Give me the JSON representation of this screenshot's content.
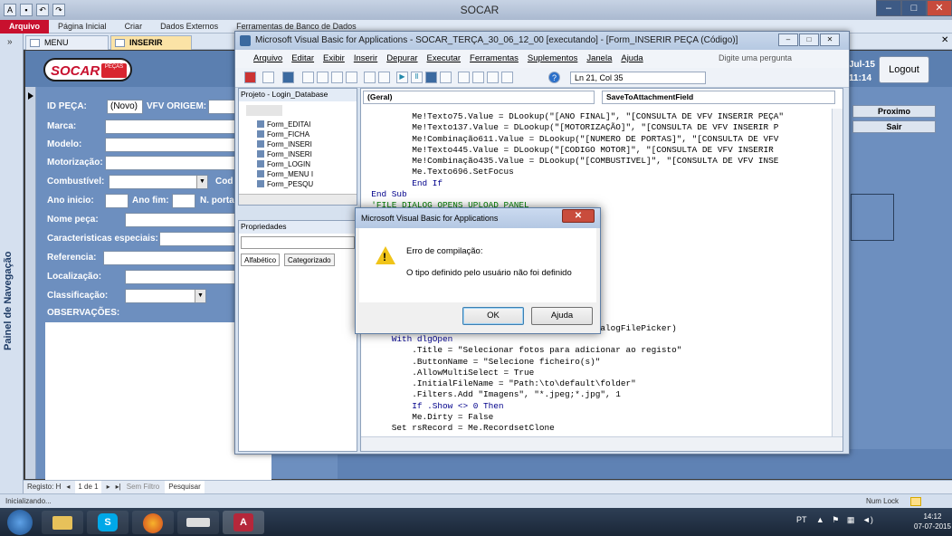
{
  "access": {
    "title": "SOCAR",
    "ribbon_tabs": [
      "Arquivo",
      "Página Inicial",
      "Criar",
      "Dados Externos",
      "Ferramentas de Banco de Dados"
    ],
    "nav_pane_label": "Painel de Navegação",
    "doc_tabs": [
      "MENU PRINCIPAL",
      "INSERIR PEÇA"
    ]
  },
  "form": {
    "logo_text": "SOCAR",
    "logo_sub": "PEÇAS",
    "id_label": "ID PEÇA:",
    "id_value": "(Novo)",
    "vfv_label": "VFV ORIGEM:",
    "labels": {
      "marca": "Marca:",
      "modelo": "Modelo:",
      "motorizacao": "Motorização:",
      "combustivel": "Combustível:",
      "cod": "Cod",
      "ano_inicio": "Ano inicio:",
      "ano_fim": "Ano fim:",
      "n_portas": "N. porta",
      "nome_peca": "Nome peça:",
      "caracteristicas": "Caracteristicas especiais:",
      "referencia": "Referencia:",
      "localizacao": "Localização:",
      "classificacao": "Classificação:",
      "observacoes": "OBSERVAÇÕES:"
    },
    "date_top": "Jul-15",
    "time_top": "11:14",
    "logout": "Logout",
    "proximo": "Proximo",
    "sair": "Sair"
  },
  "record_nav": {
    "registo": "Registo: H",
    "pos": "1 de 1",
    "filtro": "Sem Filtro",
    "pesquisar": "Pesquisar"
  },
  "status": {
    "left": "Inicializando...",
    "right": "Num Lock"
  },
  "vba": {
    "title": "Microsoft Visual Basic for Applications - SOCAR_TERÇA_30_06_12_00 [executando] - [Form_INSERIR PEÇA (Código)]",
    "menu": [
      "Arquivo",
      "Editar",
      "Exibir",
      "Inserir",
      "Depurar",
      "Executar",
      "Ferramentas",
      "Suplementos",
      "Janela",
      "Ajuda"
    ],
    "ask_placeholder": "Digite uma pergunta",
    "position": "Ln 21, Col 35",
    "project_header": "Projeto - Login_Database",
    "project_items": [
      "Form_EDITAI",
      "Form_FICHA",
      "Form_INSERI",
      "Form_INSERI",
      "Form_LOGIN",
      "Form_MENU I",
      "Form_PESQU"
    ],
    "props_header": "Propriedades",
    "props_tabs": [
      "Alfabético",
      "Categorizado"
    ],
    "object_dd": "(Geral)",
    "proc_dd": "SaveToAttachmentField",
    "code_lines": [
      {
        "indent": "        ",
        "text": "Me!Texto75.Value = DLookup(\"[ANO FINAL]\", \"[CONSULTA DE VFV INSERIR PEÇA\"",
        "cls": ""
      },
      {
        "indent": "        ",
        "text": "Me!Texto137.Value = DLookup(\"[MOTORIZAÇÃO]\", \"[CONSULTA DE VFV INSERIR P",
        "cls": ""
      },
      {
        "indent": "        ",
        "text": "Me!Combinação611.Value = DLookup(\"[NUMERO DE PORTAS]\", \"[CONSULTA DE VFV",
        "cls": ""
      },
      {
        "indent": "        ",
        "text": "Me!Texto445.Value = DLookup(\"[CODIGO MOTOR]\", \"[CONSULTA DE VFV INSERIR",
        "cls": ""
      },
      {
        "indent": "        ",
        "text": "Me!Combinação435.Value = DLookup(\"[COMBUSTIVEL]\", \"[CONSULTA DE VFV INSE",
        "cls": ""
      },
      {
        "indent": "        ",
        "text": "Me.Texto696.SetFocus",
        "cls": ""
      },
      {
        "indent": "        ",
        "text": "End If",
        "cls": "kw"
      },
      {
        "indent": "",
        "text": "End Sub",
        "cls": "kw"
      },
      {
        "indent": "",
        "text": "'FILE DIALOG OPENS UPLOAD PANEL",
        "cls": "cm"
      },
      {
        "indent": "",
        "text": "",
        "cls": ""
      },
      {
        "indent": "",
        "text": "",
        "cls": ""
      },
      {
        "indent": "",
        "text": "",
        "cls": ""
      },
      {
        "indent": "",
        "text": "",
        "cls": ""
      },
      {
        "indent": "",
        "text": "",
        "cls": ""
      },
      {
        "indent": "",
        "text": "",
        "cls": ""
      },
      {
        "indent": "",
        "text": "",
        "cls": ""
      },
      {
        "indent": "",
        "text": "",
        "cls": ""
      },
      {
        "indent": "",
        "text": "",
        "cls": ""
      },
      {
        "indent": "",
        "text": "",
        "cls": ""
      },
      {
        "indent": "                                  ",
        "text": "g(msoFileDialogFilePicker)",
        "cls": ""
      },
      {
        "indent": "    ",
        "text": "With dlgOpen",
        "cls": "kw"
      },
      {
        "indent": "        ",
        "text": ".Title = \"Selecionar fotos para adicionar ao registo\"",
        "cls": ""
      },
      {
        "indent": "        ",
        "text": ".ButtonName = \"Selecione ficheiro(s)\"",
        "cls": ""
      },
      {
        "indent": "        ",
        "text": ".AllowMultiSelect = True",
        "cls": ""
      },
      {
        "indent": "        ",
        "text": ".InitialFileName = \"Path:\\to\\default\\folder\"",
        "cls": ""
      },
      {
        "indent": "        ",
        "text": ".Filters.Add \"Imagens\", \"*.jpeg;*.jpg\", 1",
        "cls": ""
      },
      {
        "indent": "        ",
        "text": "If .Show <> 0 Then",
        "cls": "kw"
      },
      {
        "indent": "        ",
        "text": "Me.Dirty = False",
        "cls": ""
      },
      {
        "indent": "    ",
        "text": "Set rsRecord = Me.RecordsetClone",
        "cls": ""
      }
    ]
  },
  "dialog": {
    "title": "Microsoft Visual Basic for Applications",
    "heading": "Erro de compilação:",
    "message": "O tipo definido pelo usuário não foi definido",
    "ok": "OK",
    "help": "Ajuda"
  },
  "tray": {
    "lang": "PT",
    "time": "14:12",
    "date": "07-07-2015"
  }
}
